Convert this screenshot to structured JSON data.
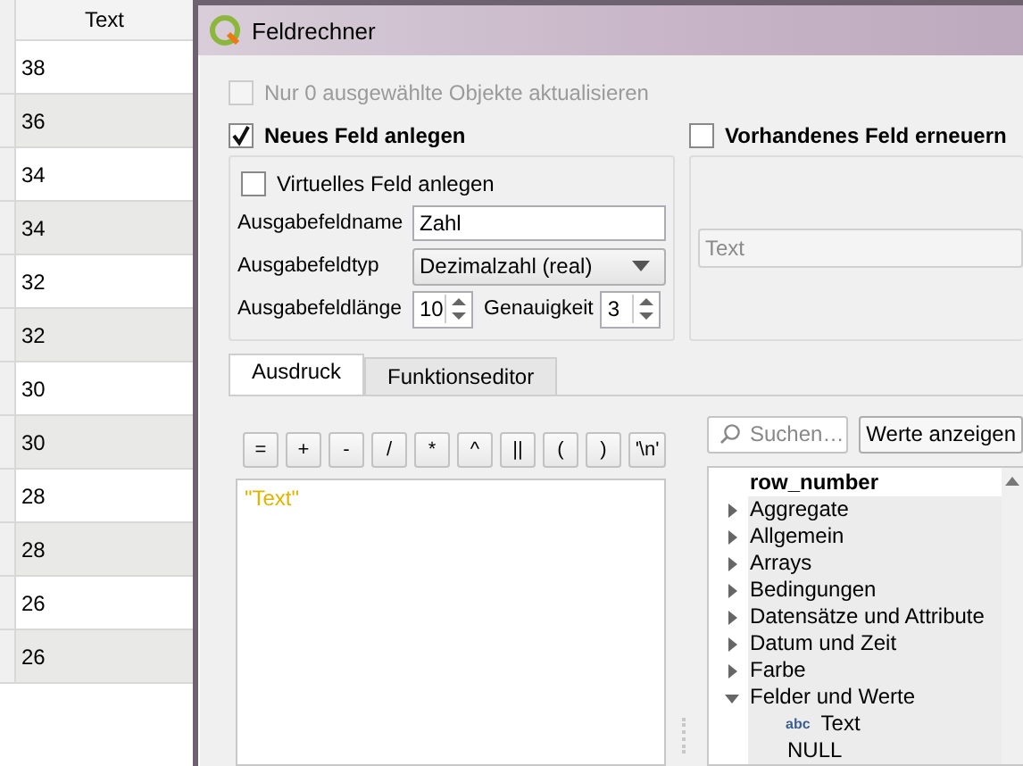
{
  "table": {
    "header": "Text",
    "rows": [
      {
        "value": "38"
      },
      {
        "value": "36"
      },
      {
        "value": "34"
      },
      {
        "value": "34"
      },
      {
        "value": "32"
      },
      {
        "value": "32"
      },
      {
        "value": "30"
      },
      {
        "value": "30"
      },
      {
        "value": "28"
      },
      {
        "value": "28"
      },
      {
        "value": "26"
      },
      {
        "value": "26"
      }
    ]
  },
  "dialog": {
    "title": "Feldrechner",
    "only_selected": {
      "label": "Nur 0 ausgewählte Objekte aktualisieren",
      "checked": false,
      "disabled": true
    },
    "new_field": {
      "label": "Neues Feld anlegen",
      "checked": true,
      "virtual": {
        "label": "Virtuelles Feld anlegen",
        "checked": false
      },
      "name": {
        "label": "Ausgabefeldname",
        "value": "Zahl"
      },
      "type": {
        "label": "Ausgabefeldtyp",
        "value": "Dezimalzahl (real)"
      },
      "length": {
        "label": "Ausgabefeldlänge",
        "value": "10"
      },
      "precision": {
        "label": "Genauigkeit",
        "value": "3"
      }
    },
    "update_field": {
      "label": "Vorhandenes Feld erneuern",
      "checked": false,
      "field": {
        "value": "Text",
        "disabled": true
      }
    },
    "tabs": [
      {
        "label": "Ausdruck",
        "selected": true
      },
      {
        "label": "Funktionseditor",
        "selected": false
      }
    ],
    "operators": [
      "=",
      "+",
      "-",
      "/",
      "*",
      "^",
      "||",
      "(",
      ")",
      "'\\n'"
    ],
    "expression": "\"Text\"",
    "search": {
      "placeholder": "Suchen…"
    },
    "show_values_button": "Werte anzeigen",
    "tree": [
      {
        "label": "row_number",
        "kind": "item"
      },
      {
        "label": "Aggregate",
        "kind": "group",
        "expanded": false
      },
      {
        "label": "Allgemein",
        "kind": "group",
        "expanded": false
      },
      {
        "label": "Arrays",
        "kind": "group",
        "expanded": false
      },
      {
        "label": "Bedingungen",
        "kind": "group",
        "expanded": false
      },
      {
        "label": "Datensätze und Attribute",
        "kind": "group",
        "expanded": false
      },
      {
        "label": "Datum und Zeit",
        "kind": "group",
        "expanded": false
      },
      {
        "label": "Farbe",
        "kind": "group",
        "expanded": false
      },
      {
        "label": "Felder und Werte",
        "kind": "group",
        "expanded": true,
        "children": [
          {
            "label": "Text",
            "kind": "field",
            "type_badge": "abc"
          },
          {
            "label": "NULL",
            "kind": "value"
          }
        ]
      }
    ]
  }
}
